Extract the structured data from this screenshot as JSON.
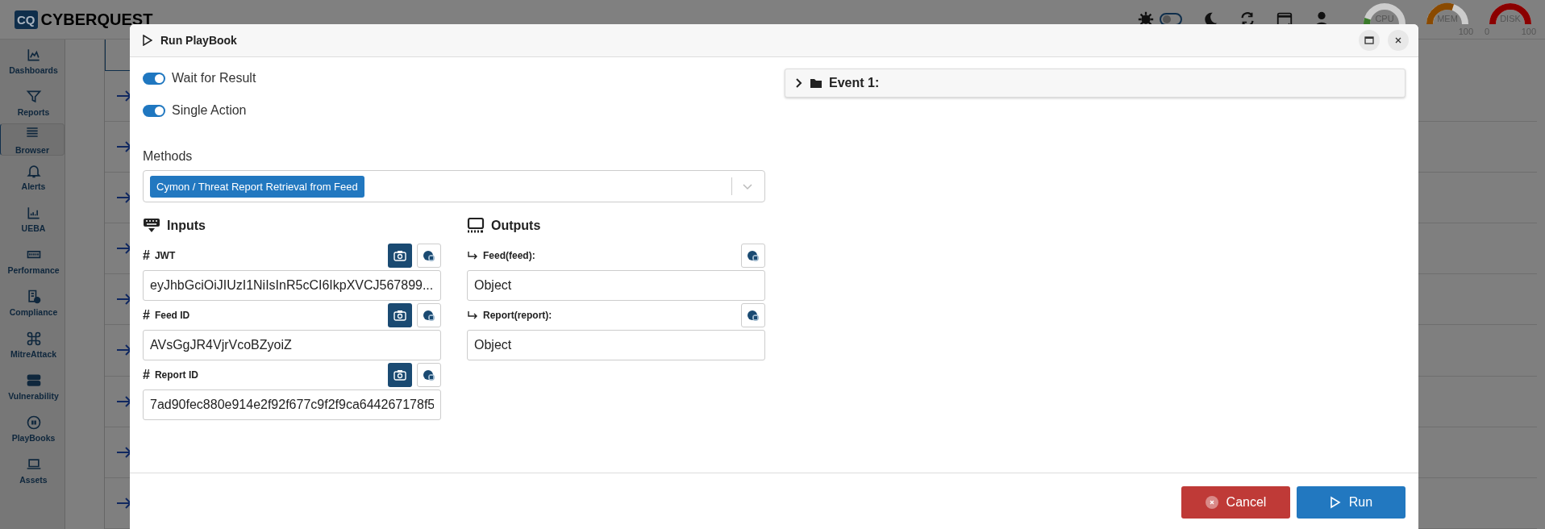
{
  "app": {
    "logo_mark": "CQ",
    "brand": "CYBERQUEST"
  },
  "header": {
    "theme_toggle": {
      "on": false
    },
    "gauges": [
      {
        "label": "CPU",
        "level": 0.1,
        "color": "#3a7a2a"
      },
      {
        "label": "MEM",
        "level": 0.6,
        "color": "#8a4a00",
        "max": "100"
      },
      {
        "label": "DISK",
        "level": 1.0,
        "color": "#8b0000",
        "min": "0",
        "max": "100"
      }
    ]
  },
  "sidebar": {
    "items": [
      {
        "label": "Dashboards",
        "selected": false
      },
      {
        "label": "Reports",
        "selected": false
      },
      {
        "label": "Browser",
        "selected": true
      },
      {
        "label": "Alerts",
        "selected": false
      },
      {
        "label": "UEBA",
        "selected": false
      },
      {
        "label": "Performance",
        "selected": false
      },
      {
        "label": "Compliance",
        "selected": false
      },
      {
        "label": "MitreAttack",
        "selected": false
      },
      {
        "label": "Vulnerability",
        "selected": false
      },
      {
        "label": "PlayBooks",
        "selected": false
      },
      {
        "label": "Assets",
        "selected": false
      }
    ]
  },
  "dialog": {
    "title": "Run PlayBook",
    "toggles": [
      {
        "label": "Wait for Result",
        "on": true
      },
      {
        "label": "Single Action",
        "on": true
      }
    ],
    "methods": {
      "label": "Methods",
      "selected_tags": [
        "Cymon / Threat Report Retrieval from Feed"
      ]
    },
    "inputs": {
      "title": "Inputs",
      "fields": [
        {
          "prefix": "#",
          "label": "JWT",
          "value": "eyJhbGciOiJIUzI1NiIsInR5cCI6IkpXVCJ567899..."
        },
        {
          "prefix": "#",
          "label": "Feed ID",
          "value": "AVsGgJR4VjrVcoBZyoiZ"
        },
        {
          "prefix": "#",
          "label": "Report ID",
          "value": "7ad90fec880e914e2f92f677c9f2f9ca644267178f5"
        }
      ]
    },
    "outputs": {
      "title": "Outputs",
      "fields": [
        {
          "label": "Feed(feed):",
          "value": "Object"
        },
        {
          "label": "Report(report):",
          "value": "Object"
        }
      ]
    },
    "event": {
      "label": "Event 1:",
      "expanded": false
    },
    "buttons": [
      {
        "label": "Cancel",
        "kind": "cancel"
      },
      {
        "label": "Run",
        "kind": "run"
      }
    ]
  }
}
